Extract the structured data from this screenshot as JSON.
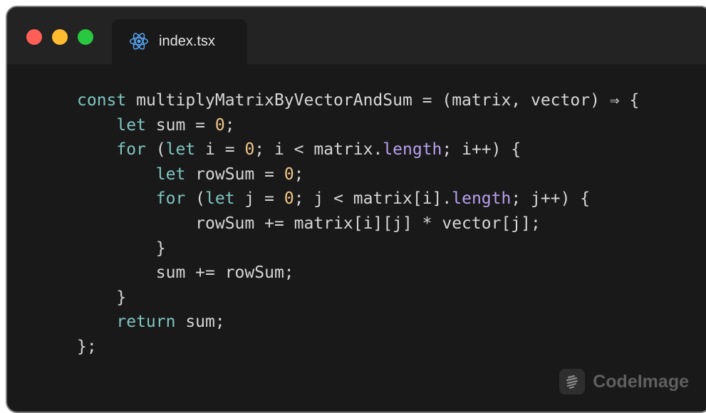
{
  "window": {
    "controls": [
      "close",
      "minimize",
      "maximize"
    ]
  },
  "tab": {
    "icon": "react-icon",
    "label": "index.tsx"
  },
  "code": {
    "language": "tsx",
    "colors": {
      "keyword": "#7fc5c0",
      "number": "#f0c78a",
      "property": "#b7a0ee",
      "text": "#d6d6d6",
      "background": "#191919"
    },
    "lines": [
      {
        "indent": 0,
        "tokens": [
          {
            "t": "kw",
            "v": "const"
          },
          {
            "t": "plain",
            "v": " multiplyMatrixByVectorAndSum = (matrix, vector) ⇒ {"
          }
        ]
      },
      {
        "indent": 1,
        "tokens": [
          {
            "t": "kw",
            "v": "let"
          },
          {
            "t": "plain",
            "v": " sum = "
          },
          {
            "t": "num",
            "v": "0"
          },
          {
            "t": "plain",
            "v": ";"
          }
        ]
      },
      {
        "indent": 1,
        "tokens": [
          {
            "t": "kw",
            "v": "for"
          },
          {
            "t": "plain",
            "v": " ("
          },
          {
            "t": "kw",
            "v": "let"
          },
          {
            "t": "plain",
            "v": " i = "
          },
          {
            "t": "num",
            "v": "0"
          },
          {
            "t": "plain",
            "v": "; i < matrix."
          },
          {
            "t": "prop",
            "v": "length"
          },
          {
            "t": "plain",
            "v": "; i++) {"
          }
        ]
      },
      {
        "indent": 2,
        "tokens": [
          {
            "t": "kw",
            "v": "let"
          },
          {
            "t": "plain",
            "v": " rowSum = "
          },
          {
            "t": "num",
            "v": "0"
          },
          {
            "t": "plain",
            "v": ";"
          }
        ]
      },
      {
        "indent": 2,
        "tokens": [
          {
            "t": "kw",
            "v": "for"
          },
          {
            "t": "plain",
            "v": " ("
          },
          {
            "t": "kw",
            "v": "let"
          },
          {
            "t": "plain",
            "v": " j = "
          },
          {
            "t": "num",
            "v": "0"
          },
          {
            "t": "plain",
            "v": "; j < matrix[i]."
          },
          {
            "t": "prop",
            "v": "length"
          },
          {
            "t": "plain",
            "v": "; j++) {"
          }
        ]
      },
      {
        "indent": 3,
        "tokens": [
          {
            "t": "plain",
            "v": "rowSum += matrix[i][j] * vector[j];"
          }
        ]
      },
      {
        "indent": 2,
        "tokens": [
          {
            "t": "plain",
            "v": "}"
          }
        ]
      },
      {
        "indent": 2,
        "tokens": [
          {
            "t": "plain",
            "v": "sum += rowSum;"
          }
        ]
      },
      {
        "indent": 1,
        "tokens": [
          {
            "t": "plain",
            "v": "}"
          }
        ]
      },
      {
        "indent": 1,
        "tokens": [
          {
            "t": "kw",
            "v": "return"
          },
          {
            "t": "plain",
            "v": " sum;"
          }
        ]
      },
      {
        "indent": 0,
        "tokens": [
          {
            "t": "plain",
            "v": "};"
          }
        ]
      }
    ]
  },
  "watermark": {
    "icon": "codeimage-logo-icon",
    "label": "CodeImage"
  }
}
